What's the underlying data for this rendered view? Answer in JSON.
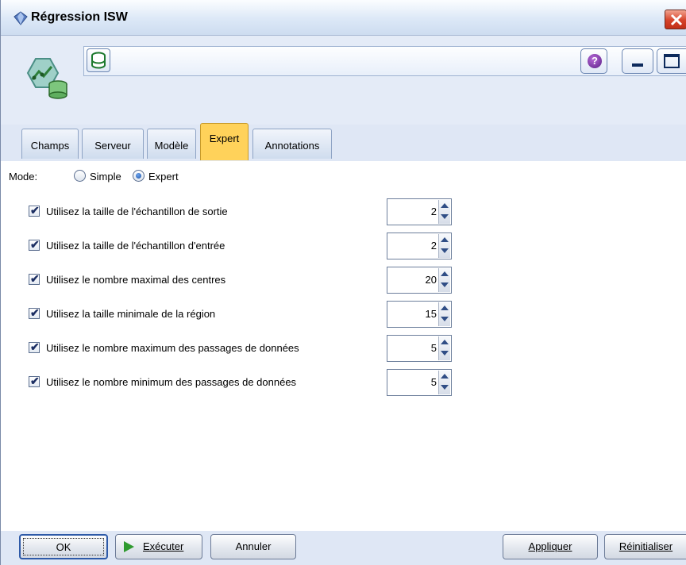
{
  "window": {
    "title": "Régression ISW"
  },
  "toolbar": {
    "help_label": "?"
  },
  "tabs": [
    {
      "label": "Champs",
      "active": false
    },
    {
      "label": "Serveur",
      "active": false
    },
    {
      "label": "Modèle",
      "active": false
    },
    {
      "label": "Expert",
      "active": true
    },
    {
      "label": "Annotations",
      "active": false
    }
  ],
  "mode": {
    "label": "Mode:",
    "options": [
      {
        "label": "Simple",
        "checked": false
      },
      {
        "label": "Expert",
        "checked": true
      }
    ]
  },
  "settings": [
    {
      "label": "Utilisez la taille de l'échantillon de sortie",
      "checked": true,
      "value": "2"
    },
    {
      "label": "Utilisez la taille de l'échantillon d'entrée",
      "checked": true,
      "value": "2"
    },
    {
      "label": "Utilisez le nombre maximal des centres",
      "checked": true,
      "value": "20"
    },
    {
      "label": "Utilisez la taille minimale de la région",
      "checked": true,
      "value": "15"
    },
    {
      "label": "Utilisez le nombre maximum des passages de données",
      "checked": true,
      "value": "5"
    },
    {
      "label": "Utilisez le nombre minimum des passages de données",
      "checked": true,
      "value": "5"
    }
  ],
  "buttons": {
    "ok": "OK",
    "run": "Exécuter",
    "cancel": "Annuler",
    "apply": "Appliquer",
    "reset": "Réinitialiser"
  },
  "colors": {
    "active_tab": "#ffd25a",
    "panel_bg": "#dfe7f5"
  }
}
